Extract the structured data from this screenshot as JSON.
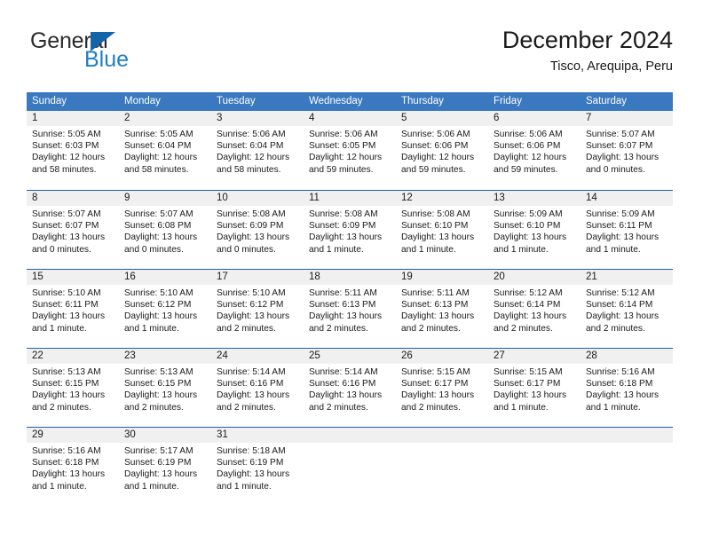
{
  "logo": {
    "word1": "General",
    "word2": "Blue",
    "triangle_color": "#1464aa",
    "blue_color": "#1f7ec4"
  },
  "header": {
    "title": "December 2024",
    "subtitle": "Tisco, Arequipa, Peru"
  },
  "calendar": {
    "header_bg": "#3a79bf",
    "row_border": "#1f5ea8",
    "daynum_bg": "#f0f0f0",
    "weekdays": [
      "Sunday",
      "Monday",
      "Tuesday",
      "Wednesday",
      "Thursday",
      "Friday",
      "Saturday"
    ],
    "weeks": [
      [
        {
          "day": "1",
          "sunrise": "Sunrise: 5:05 AM",
          "sunset": "Sunset: 6:03 PM",
          "daylight1": "Daylight: 12 hours",
          "daylight2": "and 58 minutes."
        },
        {
          "day": "2",
          "sunrise": "Sunrise: 5:05 AM",
          "sunset": "Sunset: 6:04 PM",
          "daylight1": "Daylight: 12 hours",
          "daylight2": "and 58 minutes."
        },
        {
          "day": "3",
          "sunrise": "Sunrise: 5:06 AM",
          "sunset": "Sunset: 6:04 PM",
          "daylight1": "Daylight: 12 hours",
          "daylight2": "and 58 minutes."
        },
        {
          "day": "4",
          "sunrise": "Sunrise: 5:06 AM",
          "sunset": "Sunset: 6:05 PM",
          "daylight1": "Daylight: 12 hours",
          "daylight2": "and 59 minutes."
        },
        {
          "day": "5",
          "sunrise": "Sunrise: 5:06 AM",
          "sunset": "Sunset: 6:06 PM",
          "daylight1": "Daylight: 12 hours",
          "daylight2": "and 59 minutes."
        },
        {
          "day": "6",
          "sunrise": "Sunrise: 5:06 AM",
          "sunset": "Sunset: 6:06 PM",
          "daylight1": "Daylight: 12 hours",
          "daylight2": "and 59 minutes."
        },
        {
          "day": "7",
          "sunrise": "Sunrise: 5:07 AM",
          "sunset": "Sunset: 6:07 PM",
          "daylight1": "Daylight: 13 hours",
          "daylight2": "and 0 minutes."
        }
      ],
      [
        {
          "day": "8",
          "sunrise": "Sunrise: 5:07 AM",
          "sunset": "Sunset: 6:07 PM",
          "daylight1": "Daylight: 13 hours",
          "daylight2": "and 0 minutes."
        },
        {
          "day": "9",
          "sunrise": "Sunrise: 5:07 AM",
          "sunset": "Sunset: 6:08 PM",
          "daylight1": "Daylight: 13 hours",
          "daylight2": "and 0 minutes."
        },
        {
          "day": "10",
          "sunrise": "Sunrise: 5:08 AM",
          "sunset": "Sunset: 6:09 PM",
          "daylight1": "Daylight: 13 hours",
          "daylight2": "and 0 minutes."
        },
        {
          "day": "11",
          "sunrise": "Sunrise: 5:08 AM",
          "sunset": "Sunset: 6:09 PM",
          "daylight1": "Daylight: 13 hours",
          "daylight2": "and 1 minute."
        },
        {
          "day": "12",
          "sunrise": "Sunrise: 5:08 AM",
          "sunset": "Sunset: 6:10 PM",
          "daylight1": "Daylight: 13 hours",
          "daylight2": "and 1 minute."
        },
        {
          "day": "13",
          "sunrise": "Sunrise: 5:09 AM",
          "sunset": "Sunset: 6:10 PM",
          "daylight1": "Daylight: 13 hours",
          "daylight2": "and 1 minute."
        },
        {
          "day": "14",
          "sunrise": "Sunrise: 5:09 AM",
          "sunset": "Sunset: 6:11 PM",
          "daylight1": "Daylight: 13 hours",
          "daylight2": "and 1 minute."
        }
      ],
      [
        {
          "day": "15",
          "sunrise": "Sunrise: 5:10 AM",
          "sunset": "Sunset: 6:11 PM",
          "daylight1": "Daylight: 13 hours",
          "daylight2": "and 1 minute."
        },
        {
          "day": "16",
          "sunrise": "Sunrise: 5:10 AM",
          "sunset": "Sunset: 6:12 PM",
          "daylight1": "Daylight: 13 hours",
          "daylight2": "and 1 minute."
        },
        {
          "day": "17",
          "sunrise": "Sunrise: 5:10 AM",
          "sunset": "Sunset: 6:12 PM",
          "daylight1": "Daylight: 13 hours",
          "daylight2": "and 2 minutes."
        },
        {
          "day": "18",
          "sunrise": "Sunrise: 5:11 AM",
          "sunset": "Sunset: 6:13 PM",
          "daylight1": "Daylight: 13 hours",
          "daylight2": "and 2 minutes."
        },
        {
          "day": "19",
          "sunrise": "Sunrise: 5:11 AM",
          "sunset": "Sunset: 6:13 PM",
          "daylight1": "Daylight: 13 hours",
          "daylight2": "and 2 minutes."
        },
        {
          "day": "20",
          "sunrise": "Sunrise: 5:12 AM",
          "sunset": "Sunset: 6:14 PM",
          "daylight1": "Daylight: 13 hours",
          "daylight2": "and 2 minutes."
        },
        {
          "day": "21",
          "sunrise": "Sunrise: 5:12 AM",
          "sunset": "Sunset: 6:14 PM",
          "daylight1": "Daylight: 13 hours",
          "daylight2": "and 2 minutes."
        }
      ],
      [
        {
          "day": "22",
          "sunrise": "Sunrise: 5:13 AM",
          "sunset": "Sunset: 6:15 PM",
          "daylight1": "Daylight: 13 hours",
          "daylight2": "and 2 minutes."
        },
        {
          "day": "23",
          "sunrise": "Sunrise: 5:13 AM",
          "sunset": "Sunset: 6:15 PM",
          "daylight1": "Daylight: 13 hours",
          "daylight2": "and 2 minutes."
        },
        {
          "day": "24",
          "sunrise": "Sunrise: 5:14 AM",
          "sunset": "Sunset: 6:16 PM",
          "daylight1": "Daylight: 13 hours",
          "daylight2": "and 2 minutes."
        },
        {
          "day": "25",
          "sunrise": "Sunrise: 5:14 AM",
          "sunset": "Sunset: 6:16 PM",
          "daylight1": "Daylight: 13 hours",
          "daylight2": "and 2 minutes."
        },
        {
          "day": "26",
          "sunrise": "Sunrise: 5:15 AM",
          "sunset": "Sunset: 6:17 PM",
          "daylight1": "Daylight: 13 hours",
          "daylight2": "and 2 minutes."
        },
        {
          "day": "27",
          "sunrise": "Sunrise: 5:15 AM",
          "sunset": "Sunset: 6:17 PM",
          "daylight1": "Daylight: 13 hours",
          "daylight2": "and 1 minute."
        },
        {
          "day": "28",
          "sunrise": "Sunrise: 5:16 AM",
          "sunset": "Sunset: 6:18 PM",
          "daylight1": "Daylight: 13 hours",
          "daylight2": "and 1 minute."
        }
      ],
      [
        {
          "day": "29",
          "sunrise": "Sunrise: 5:16 AM",
          "sunset": "Sunset: 6:18 PM",
          "daylight1": "Daylight: 13 hours",
          "daylight2": "and 1 minute."
        },
        {
          "day": "30",
          "sunrise": "Sunrise: 5:17 AM",
          "sunset": "Sunset: 6:19 PM",
          "daylight1": "Daylight: 13 hours",
          "daylight2": "and 1 minute."
        },
        {
          "day": "31",
          "sunrise": "Sunrise: 5:18 AM",
          "sunset": "Sunset: 6:19 PM",
          "daylight1": "Daylight: 13 hours",
          "daylight2": "and 1 minute."
        },
        {
          "day": "",
          "sunrise": "",
          "sunset": "",
          "daylight1": "",
          "daylight2": ""
        },
        {
          "day": "",
          "sunrise": "",
          "sunset": "",
          "daylight1": "",
          "daylight2": ""
        },
        {
          "day": "",
          "sunrise": "",
          "sunset": "",
          "daylight1": "",
          "daylight2": ""
        },
        {
          "day": "",
          "sunrise": "",
          "sunset": "",
          "daylight1": "",
          "daylight2": ""
        }
      ]
    ]
  }
}
